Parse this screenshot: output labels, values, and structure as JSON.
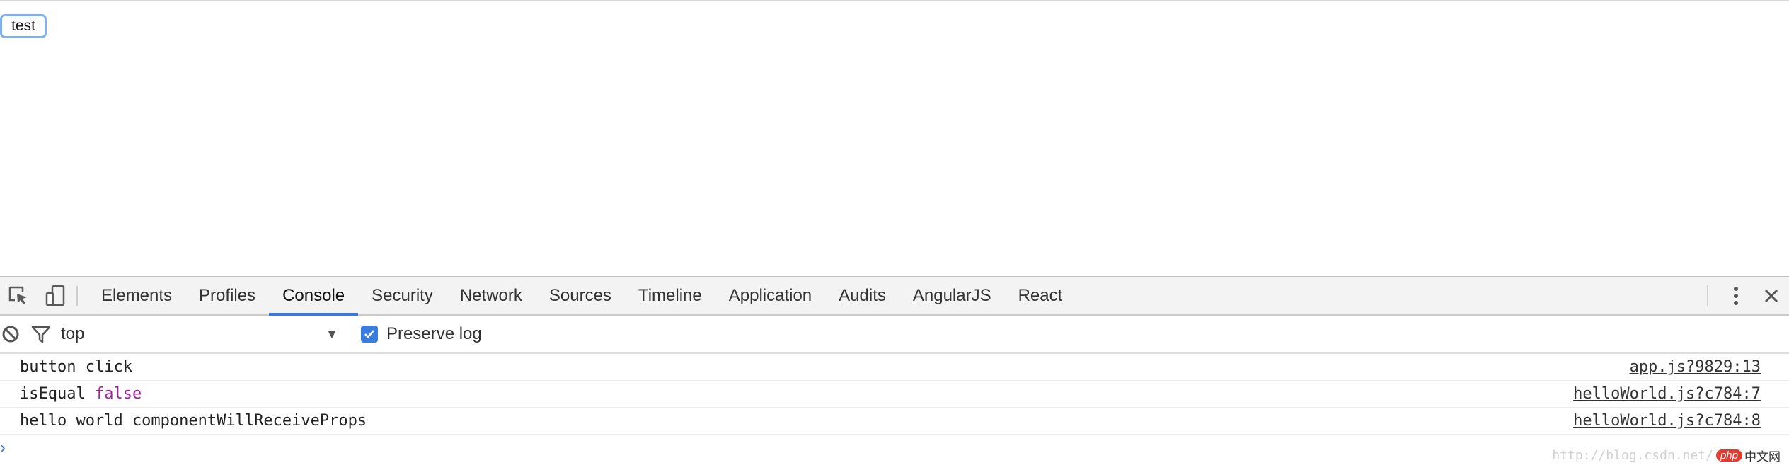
{
  "page": {
    "button_label": "test"
  },
  "devtools": {
    "tabs": [
      {
        "label": "Elements"
      },
      {
        "label": "Profiles"
      },
      {
        "label": "Console"
      },
      {
        "label": "Security"
      },
      {
        "label": "Network"
      },
      {
        "label": "Sources"
      },
      {
        "label": "Timeline"
      },
      {
        "label": "Application"
      },
      {
        "label": "Audits"
      },
      {
        "label": "AngularJS"
      },
      {
        "label": "React"
      }
    ],
    "active_tab": "Console",
    "filter": {
      "context": "top",
      "preserve_log_label": "Preserve log",
      "preserve_log_checked": true
    },
    "logs": [
      {
        "message": "button click",
        "source": "app.js?9829:13"
      },
      {
        "message": "isEqual",
        "value": "false",
        "source": "helloWorld.js?c784:7"
      },
      {
        "message": "hello world componentWillReceiveProps",
        "source": "helloWorld.js?c784:8"
      }
    ],
    "prompt_symbol": "›"
  },
  "watermark": {
    "url": "http://blog.csdn.net/",
    "badge_php": "php",
    "badge_text": "中文网"
  },
  "colors": {
    "active_tab_underline": "#3879d9",
    "checkbox": "#3b7ddd",
    "false_keyword": "#a8219c"
  }
}
